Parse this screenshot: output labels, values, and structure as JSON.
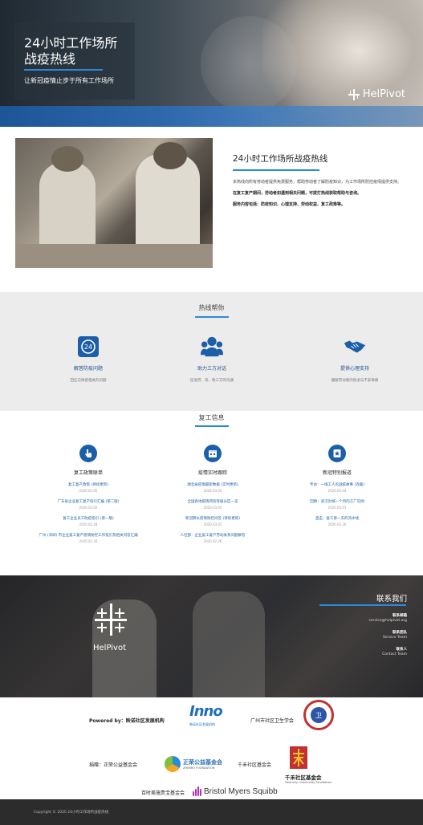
{
  "hero": {
    "title": "24小时工作场所战疫热线",
    "subtitle": "让新冠疫情止步于所有工作场所",
    "brand": "HelPivot"
  },
  "about": {
    "title": "24小时工作场所战疫热线",
    "paragraphs": [
      "本热线向所有劳动者提供免费服务，帮助劳动者了解防疫知识，为工作场所防控疫情提供支持。",
      "在复工复产期间，劳动者如遇到相关问题，可拨打热线获取帮助与咨询。",
      "服务内容包括：防疫知识、心理支持、劳动权益、复工政策等。"
    ]
  },
  "hotline": {
    "title": "热线帮你",
    "items": [
      {
        "title": "解答防疫问题",
        "desc": "回应与防疫相关的问题",
        "icon": "calendar-24-icon"
      },
      {
        "title": "助力三方对话",
        "desc": "促进劳、资、政三方的沟通",
        "icon": "people-icon"
      },
      {
        "title": "提供心理支持",
        "desc": "缓解劳动者的焦虑与不安情绪",
        "icon": "handshake-icon"
      }
    ]
  },
  "return": {
    "title": "复工信息",
    "columns": [
      {
        "title": "复工政策联单",
        "icon": "hand-pointer-icon",
        "links": [
          {
            "text": "复工复产政策 (持续更新)",
            "date": "2020.03.05"
          },
          {
            "text": "广东省企业复工复产指引汇编 (第二版)",
            "date": "2020.03.02"
          },
          {
            "text": "复工企业员工防疫指引 (第一版)",
            "date": "2020.02.28"
          },
          {
            "text": "广州 (深圳) 市企业复工复产疫情防控工作指引及相关问答汇编",
            "date": "2020.02.26"
          }
        ]
      },
      {
        "title": "疫情实时跟踪",
        "icon": "calendar-icon",
        "links": [
          {
            "text": "湖北省疫情最新数据 (实时更新)",
            "date": "2020.03.05"
          },
          {
            "text": "全国各地疫情风险等级分区一览",
            "date": "2020.03.03"
          },
          {
            "text": "新冠肺炎疫情防控问答 (持续更新)",
            "date": "2020.03.01"
          },
          {
            "text": "人社部：企业复工复产劳动关系问题解答",
            "date": "2020.02.26"
          }
        ]
      },
      {
        "title": "新冠特别报道",
        "icon": "star-badge-icon",
        "links": [
          {
            "text": "专访：一线工人的战疫故事 (连载)",
            "date": "2020.03.04"
          },
          {
            "text": "回顾：武汉封城一个月的工厂见闻",
            "date": "2020.03.01"
          },
          {
            "text": "直击：复工第一天的流水线",
            "date": "2020.02.26"
          }
        ]
      }
    ]
  },
  "contact": {
    "title": "联系我们",
    "brand": "HelPivot",
    "items": [
      {
        "key": "联系邮箱",
        "value": "service@helpivot.org"
      },
      {
        "key": "联系团队",
        "value": "Service Team"
      },
      {
        "key": "联系人",
        "value": "Contact Team"
      }
    ]
  },
  "sponsors": {
    "powered_by": "Powered by：映诺社区发展机构",
    "inno_logo": "Inno",
    "inno_sub": "映诺社区发展机构",
    "guangzhou": "广州市社区卫生学会",
    "seal_text": "卫",
    "donor_label": "捐赠：正荣公益基金会",
    "zhengrong": "正荣公益基金会",
    "zhengrong_en": "ZHENRO FOUNDATION",
    "qianhe_label": "千禾社区基金会",
    "qianhe_title": "千禾社区基金会",
    "qianhe_en": "Harmony Community Foundation",
    "bms_label": "百时美施贵宝基金会",
    "bms_name": "Bristol Myers Squibb"
  },
  "footer": {
    "copyright": "Copyright © 2020 24小时工作场所战疫热线"
  },
  "colors": {
    "accent": "#2a8ad8",
    "brand_blue": "#1d5ea8",
    "footer_bg": "#2c2c2c"
  }
}
